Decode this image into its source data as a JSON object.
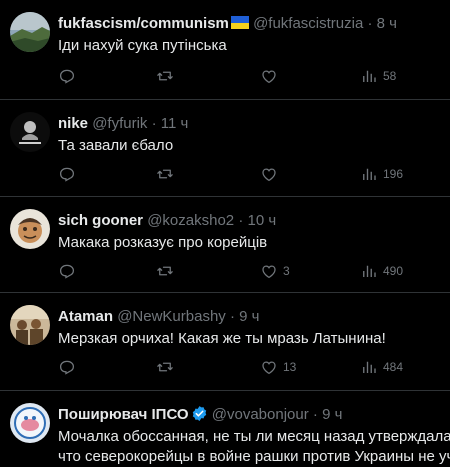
{
  "tweets": [
    {
      "name": "fukfascism/communism",
      "handle": "@fukfascistruzia",
      "time": "8 ч",
      "text": "Іди нахуй сука путінська",
      "replies": "",
      "retweets": "",
      "likes": "",
      "views": "58",
      "badge": "ukraine-flag"
    },
    {
      "name": "nike",
      "handle": "@fyfurik",
      "time": "11 ч",
      "text": "Та завали єбало",
      "replies": "",
      "retweets": "",
      "likes": "",
      "views": "196"
    },
    {
      "name": "sich gooner",
      "handle": "@kozaksho2",
      "time": "10 ч",
      "text": "Макака розказує про корейців",
      "replies": "",
      "retweets": "",
      "likes": "3",
      "views": "490"
    },
    {
      "name": "Ataman",
      "handle": "@NewKurbashy",
      "time": "9 ч",
      "text": "Мерзкая орчиха! Какая же ты мразь Латынина!",
      "replies": "",
      "retweets": "",
      "likes": "13",
      "views": "484"
    },
    {
      "name": "Поширювач ІПСО",
      "handle": "@vovabonjour",
      "time": "9 ч",
      "text_line1": "Мочалка обоссанная, не ты ли месяц назад утверждала,",
      "text_line2": "что северокорейцы в войне рашки против Украины не участвуют",
      "badge": "verified"
    }
  ],
  "separator": "·",
  "colors": {
    "background": "#000000",
    "text": "#e7e9ea",
    "muted": "#71767b",
    "border": "#2f3336",
    "verified": "#1d9bf0"
  },
  "icons": [
    "reply-icon",
    "retweet-icon",
    "like-icon",
    "views-icon",
    "verified-icon"
  ]
}
